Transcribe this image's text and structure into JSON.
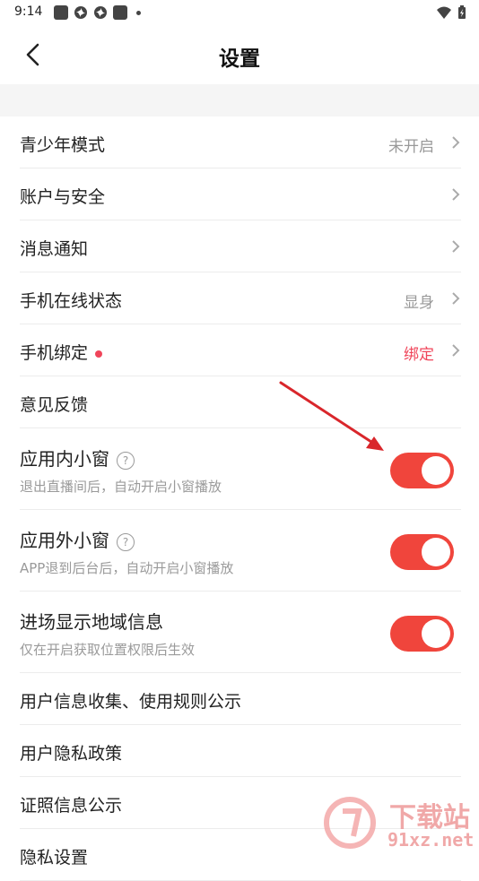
{
  "status": {
    "time": "9:14"
  },
  "header": {
    "title": "设置"
  },
  "rows": [
    {
      "label": "青少年模式",
      "value": "未开启"
    },
    {
      "label": "账户与安全"
    },
    {
      "label": "消息通知"
    },
    {
      "label": "手机在线状态",
      "value": "显身"
    },
    {
      "label": "手机绑定",
      "value": "绑定"
    },
    {
      "label": "意见反馈"
    }
  ],
  "toggles": [
    {
      "label": "应用内小窗",
      "sub": "退出直播间后，自动开启小窗播放",
      "on": true
    },
    {
      "label": "应用外小窗",
      "sub": "APP退到后台后，自动开启小窗播放",
      "on": true
    },
    {
      "label": "进场显示地域信息",
      "sub": "仅在开启获取位置权限后生效",
      "on": true
    }
  ],
  "links": [
    {
      "label": "用户信息收集、使用规则公示"
    },
    {
      "label": "用户隐私政策"
    },
    {
      "label": "证照信息公示"
    },
    {
      "label": "隐私设置"
    }
  ],
  "watermark": {
    "brand": "下载站",
    "site": "91xz.net"
  },
  "colors": {
    "accent": "#f0453c",
    "binding_red": "#f0455a"
  }
}
